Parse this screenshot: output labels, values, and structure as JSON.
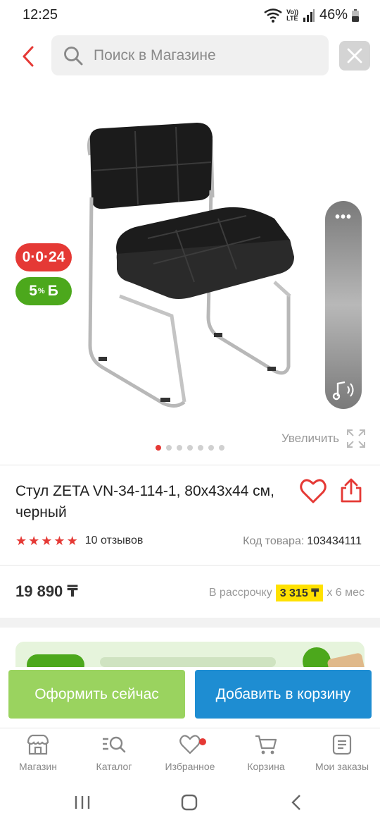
{
  "status_bar": {
    "time": "12:25",
    "lte_top": "Vo))",
    "lte_bottom": "LTE",
    "battery": "46%"
  },
  "search": {
    "placeholder": "Поиск в Магазине",
    "back_icon": "chevron-left-icon",
    "close_icon": "close-icon"
  },
  "gallery": {
    "installment_badge": "0·0·24",
    "bonus_badge_value": "5",
    "bonus_badge_pct": "%",
    "bonus_badge_letter": "Б",
    "zoom_label": "Увеличить",
    "slide_count": 7,
    "active_slide": 1,
    "floating_panel_dots": "•••"
  },
  "product": {
    "title": "Стул ZETA VN-34-114-1, 80х43х44 см, черный",
    "rating": 5,
    "reviews": "10 отзывов",
    "sku_label": "Код товара:",
    "sku_value": "103434111"
  },
  "price": {
    "value": "19 890 ₸",
    "installment_prefix": "В рассрочку",
    "installment_amount": "3 315 ₸",
    "installment_suffix": "х 6 мес"
  },
  "actions": {
    "buy_now": "Оформить сейчас",
    "add_to_cart": "Добавить в корзину"
  },
  "nav": {
    "items": [
      {
        "label": "Магазин",
        "icon": "shop-icon"
      },
      {
        "label": "Каталог",
        "icon": "catalog-search-icon"
      },
      {
        "label": "Избранное",
        "icon": "heart-icon"
      },
      {
        "label": "Корзина",
        "icon": "cart-icon"
      },
      {
        "label": "Мои заказы",
        "icon": "orders-icon"
      }
    ]
  },
  "colors": {
    "accent_red": "#e53935",
    "bonus_green": "#4ca81c",
    "buy_green": "#9ad35f",
    "cart_blue": "#1e8dd2",
    "installment_yellow": "#ffe100"
  }
}
